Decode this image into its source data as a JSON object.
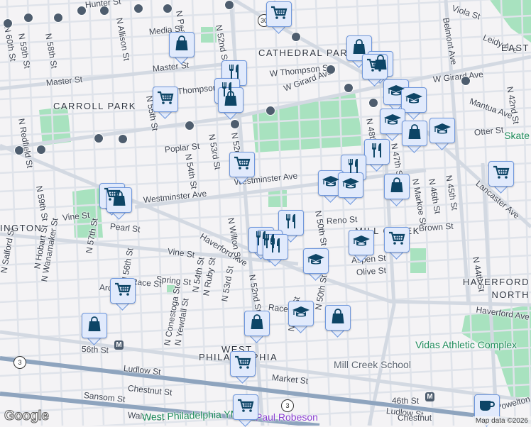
{
  "map": {
    "attribution": "Map data ©2026",
    "logo": "Google",
    "labels": [
      "Hunter St",
      "N 59th St",
      "N 58th St",
      "N Allison St",
      "N Peach St",
      "Media St",
      "Master St",
      "Master St",
      "N 52nd St",
      "CARROLL PARK",
      "N Redfield St",
      "N 55th St",
      "Thompson St",
      "Poplar St",
      "N 53rd St",
      "N 54th St",
      "N 52nd St",
      "N 59th St",
      "Westminster Ave",
      "CATHEDRAL PARK",
      "W Thompson St",
      "W Girard Ave",
      "W Girard Ave",
      "Belmont Ave",
      "Viola St",
      "Leidy Ave",
      "Mantua Ave",
      "N 42nd St",
      "Otter St",
      "Skate",
      "Lancaster Ave",
      "N 48th St",
      "N 47th St",
      "N Markoe St",
      "N 46th St",
      "N 45th St",
      "N 44th St",
      "Westminster Ave",
      "Haverford Ave",
      "Vine St",
      "Vine St",
      "Pearl St",
      "N 57th St",
      "N Salford St",
      "N Hobart St",
      "N Wanamaker St",
      "N 56th St",
      "Spring St",
      "Race St",
      "Arch St",
      "N Conestoga St",
      "N Yewdall St",
      "N 54th St",
      "N Ruby St",
      "N 53rd St",
      "N Wilton St",
      "N 52nd St",
      "56th St",
      "Ludlow St",
      "Chestnut St",
      "Sansom St",
      "Walnut St",
      "WEST",
      "PHILADELPHIA",
      "West Philadelphia YMCA",
      "Reno St",
      "MILL CREEK",
      "Brown St",
      "Aspen St",
      "Olive St",
      "HAVERFORD",
      "NORTH",
      "Haverford Ave",
      "Vidas Athletic Complex",
      "Mill Creek School",
      "Market St",
      "46th St",
      "Ludlow St",
      "N 50th St",
      "N 51st St",
      "Race St",
      "EAST",
      "Paul Robeson",
      "Powelton",
      "INGTON",
      "Chestnut",
      "N 60th St",
      "N 50th St"
    ],
    "route_shields": [
      "30",
      "3",
      "3"
    ],
    "metro_stations": [
      "M",
      "M"
    ],
    "markers": [
      {
        "icon": "cart-icon",
        "category": "grocery"
      },
      {
        "icon": "bag-icon",
        "category": "shopping"
      },
      {
        "icon": "fork-knife-icon",
        "category": "restaurant"
      },
      {
        "icon": "fork-knife-icon",
        "category": "restaurant"
      },
      {
        "icon": "bag-icon",
        "category": "shopping"
      },
      {
        "icon": "cart-icon",
        "category": "grocery"
      },
      {
        "icon": "bag-icon",
        "category": "shopping"
      },
      {
        "icon": "bag-icon",
        "category": "shopping"
      },
      {
        "icon": "cart-icon",
        "category": "grocery"
      },
      {
        "icon": "grad-cap-icon",
        "category": "school"
      },
      {
        "icon": "grad-cap-icon",
        "category": "school"
      },
      {
        "icon": "grad-cap-icon",
        "category": "school"
      },
      {
        "icon": "bag-icon",
        "category": "shopping"
      },
      {
        "icon": "grad-cap-icon",
        "category": "school"
      },
      {
        "icon": "fork-knife-icon",
        "category": "restaurant"
      },
      {
        "icon": "fork-knife-icon",
        "category": "restaurant"
      },
      {
        "icon": "grad-cap-icon",
        "category": "school"
      },
      {
        "icon": "grad-cap-icon",
        "category": "school"
      },
      {
        "icon": "bag-icon",
        "category": "shopping"
      },
      {
        "icon": "cart-icon",
        "category": "grocery"
      },
      {
        "icon": "cart-icon",
        "category": "grocery"
      },
      {
        "icon": "cart-icon",
        "category": "grocery"
      },
      {
        "icon": "bag-icon",
        "category": "shopping"
      },
      {
        "icon": "fork-knife-icon",
        "category": "restaurant"
      },
      {
        "icon": "fork-knife-icon",
        "category": "restaurant"
      },
      {
        "icon": "fork-knife-icon",
        "category": "restaurant"
      },
      {
        "icon": "fork-knife-icon",
        "category": "restaurant"
      },
      {
        "icon": "grad-cap-icon",
        "category": "school"
      },
      {
        "icon": "grad-cap-icon",
        "category": "school"
      },
      {
        "icon": "cart-icon",
        "category": "grocery"
      },
      {
        "icon": "grad-cap-icon",
        "category": "school"
      },
      {
        "icon": "bag-icon",
        "category": "shopping"
      },
      {
        "icon": "cart-icon",
        "category": "grocery"
      },
      {
        "icon": "bag-icon",
        "category": "shopping"
      },
      {
        "icon": "bag-icon",
        "category": "shopping"
      },
      {
        "icon": "cart-icon",
        "category": "grocery"
      },
      {
        "icon": "cart-icon",
        "category": "grocery"
      },
      {
        "icon": "coffee-icon",
        "category": "cafe"
      }
    ],
    "colors": {
      "background": "#f4f3f5",
      "park": "#a8e2bf",
      "road": "#d6dce4",
      "highway": "#8da3bd",
      "marker_fill": "#e1eafc",
      "marker_border": "#6f97dc",
      "icon": "#0d4566"
    }
  }
}
